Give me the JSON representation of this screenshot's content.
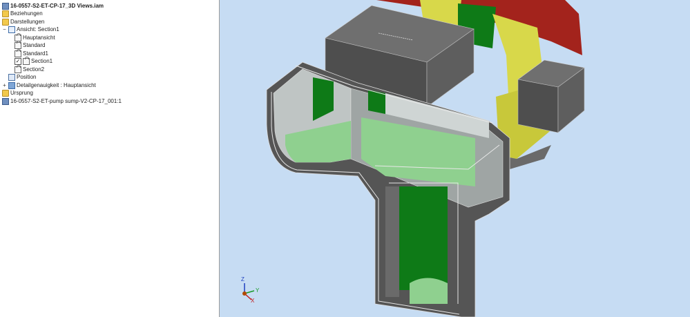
{
  "browser": {
    "root": "16-0557-S2-ET-CP-17_3D Views.iam",
    "items": [
      {
        "label": "Beziehungen"
      },
      {
        "label": "Darstellungen"
      },
      {
        "label": "Ansicht: Section1"
      },
      {
        "label": "Hauptansicht"
      },
      {
        "label": "Standard"
      },
      {
        "label": "Standard1"
      },
      {
        "label": "Section1"
      },
      {
        "label": "Section2"
      },
      {
        "label": "Position"
      },
      {
        "label": "Detailgenauigkeit : Hauptansicht"
      },
      {
        "label": "Ursprung"
      },
      {
        "label": "16-0557-S2-ET-pump sump-V2-CP-17_001:1"
      }
    ],
    "expand_minus": "−",
    "expand_plus": "+",
    "checkmark": "✓"
  },
  "viewport": {
    "axis_x": "X",
    "axis_y": "Y",
    "axis_z": "Z",
    "colors": {
      "background": "#c6dcf3",
      "concrete": "#545454",
      "concrete_top": "#6a6a6a",
      "inner_wall": "#bfc5c4",
      "green_dark": "#0e7a17",
      "green_light": "#8fd08f",
      "yellow": "#d8d84a",
      "red": "#a3231c"
    }
  }
}
